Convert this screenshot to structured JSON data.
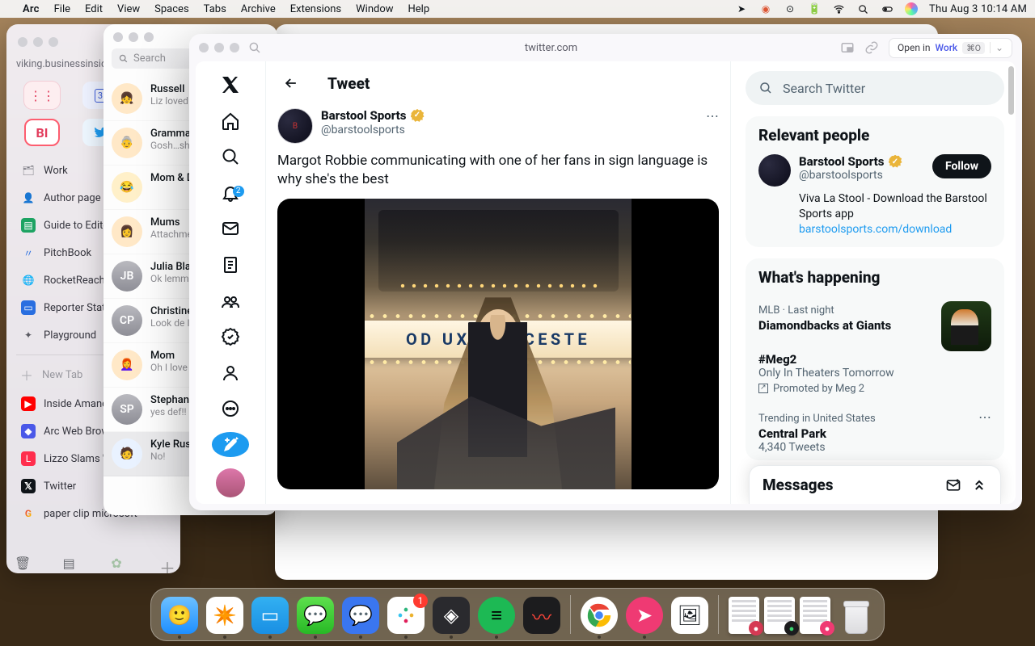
{
  "menubar": {
    "app": "Arc",
    "items": [
      "File",
      "Edit",
      "View",
      "Spaces",
      "Tabs",
      "Archive",
      "Extensions",
      "Window",
      "Help"
    ],
    "clock": "Thu Aug 3  10:14 AM"
  },
  "arc_sidebar": {
    "url": "viking.businessinside",
    "spaces": {
      "a1": "⋮⋮",
      "a2": "🗓",
      "b1": "BI",
      "b2": "tw"
    },
    "pinned": [
      {
        "icon": "📄",
        "color": "#7a7a82",
        "label": "Work"
      },
      {
        "icon": "👤",
        "color": "#3a6bd8",
        "label": "Author page"
      },
      {
        "icon": "📗",
        "color": "#1da362",
        "label": "Guide to Editor"
      },
      {
        "icon": "📘",
        "color": "#2a6fe0",
        "label": "PitchBook"
      },
      {
        "icon": "🌐",
        "color": "#2a6fe0",
        "label": "RocketReach S"
      },
      {
        "icon": "🗂",
        "color": "#2a6fe0",
        "label": "Reporter Stats"
      },
      {
        "icon": "✦",
        "color": "#5a5a62",
        "label": "Playground"
      }
    ],
    "new_tab": "New Tab",
    "tabs": [
      {
        "icon": "▶",
        "color": "#ff0000",
        "label": "Inside Amanda"
      },
      {
        "icon": "◆",
        "color": "#4a58e8",
        "label": "Arc Web Brows"
      },
      {
        "icon": "🟥",
        "color": "#ff2e4d",
        "label": "Lizzo Slams 'O"
      },
      {
        "icon": "𝕏",
        "color": "#0f1419",
        "label": "Twitter"
      },
      {
        "icon": "G",
        "color": "#4285f4",
        "label": "paper clip microsoft"
      }
    ]
  },
  "messages": {
    "search_placeholder": "Search",
    "threads": [
      {
        "initials": "",
        "emoji": "👧",
        "name": "Russell ",
        "preview": "Liz loved"
      },
      {
        "initials": "",
        "emoji": "👵",
        "name": "Gramma",
        "preview": "Gosh…sh don't you"
      },
      {
        "initials": "",
        "emoji": "😂",
        "name": "Mom & D",
        "preview": ""
      },
      {
        "initials": "",
        "emoji": "👩",
        "name": "Mums",
        "preview": "Attachme"
      },
      {
        "initials": "JB",
        "emoji": "",
        "name": "Julia Bla",
        "preview": "Ok lemme ❤️"
      },
      {
        "initials": "CP",
        "emoji": "",
        "name": "Christine",
        "preview": "Look de I never ge"
      },
      {
        "initials": "",
        "emoji": "👩‍🦰",
        "name": "Mom",
        "preview": "Oh I love"
      },
      {
        "initials": "SP",
        "emoji": "",
        "name": "Stephan",
        "preview": "yes def!!"
      },
      {
        "initials": "",
        "emoji": "🧑",
        "name": "Kyle Rus",
        "preview": "No!",
        "selected": true
      }
    ]
  },
  "arc_main": {
    "url": "twitter.com",
    "open_in_label": "Open in",
    "open_in_target": "Work",
    "open_in_kbd": "⌘O"
  },
  "twitter": {
    "nav_badge": "2",
    "header_title": "Tweet",
    "search_placeholder": "Search Twitter",
    "tweet": {
      "author": "Barstool Sports",
      "handle": "@barstoolsports",
      "text": "Margot Robbie communicating with one of her fans in sign language is why she's the best",
      "marquee": "OD      UXE LEICESTE"
    },
    "relevant": {
      "title": "Relevant people",
      "name": "Barstool Sports",
      "handle": "@barstoolsports",
      "follow": "Follow",
      "desc": "Viva La Stool - Download the Barstool Sports app",
      "link": "barstoolsports.com/download"
    },
    "happening": {
      "title": "What's happening",
      "item1": {
        "meta": "MLB · Last night",
        "title": "Diamondbacks at Giants"
      },
      "item2": {
        "title": "#Meg2",
        "sub": "Only In Theaters Tomorrow",
        "promo": "Promoted by Meg 2"
      },
      "item3": {
        "meta": "Trending in United States",
        "title": "Central Park",
        "sub": "4,340 Tweets"
      }
    },
    "dm": {
      "title": "Messages"
    }
  },
  "dock": {
    "apps": [
      {
        "name": "finder",
        "color": "#4aa8ff",
        "symbol": "☺",
        "running": true
      },
      {
        "name": "arc",
        "color": "#ffffff",
        "symbol": "✦",
        "running": true
      },
      {
        "name": "bitwarden",
        "color": "#1a8fe3",
        "symbol": "🗝",
        "running": true
      },
      {
        "name": "messages",
        "color": "#34c759",
        "symbol": "💬",
        "running": true
      },
      {
        "name": "signal",
        "color": "#3a76f0",
        "symbol": "🗨",
        "running": true
      },
      {
        "name": "slack",
        "color": "#ffffff",
        "symbol": "⋮⋮",
        "running": true,
        "badge": "1"
      },
      {
        "name": "diamond",
        "color": "#2a2a2e",
        "symbol": "◈",
        "running": true
      },
      {
        "name": "spotify",
        "color": "#1db954",
        "symbol": "≡",
        "running": true
      },
      {
        "name": "voice-memos",
        "color": "#1c1c1e",
        "symbol": "〰",
        "running": false
      }
    ],
    "apps2": [
      {
        "name": "chrome",
        "color": "#ffffff",
        "symbol": "◎",
        "running": true
      },
      {
        "name": "pink",
        "color": "#ef3a73",
        "symbol": "➤",
        "running": true
      },
      {
        "name": "photo",
        "color": "#ffffff",
        "symbol": "🖼",
        "running": false
      }
    ]
  }
}
